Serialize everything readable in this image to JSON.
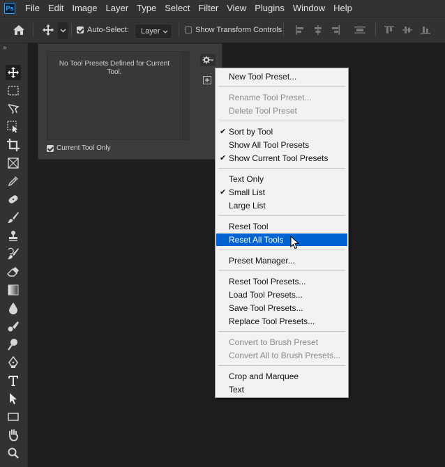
{
  "menubar": {
    "logo": "Ps",
    "items": [
      "File",
      "Edit",
      "Image",
      "Layer",
      "Type",
      "Select",
      "Filter",
      "View",
      "Plugins",
      "Window",
      "Help"
    ]
  },
  "options": {
    "auto_select_label": "Auto-Select:",
    "auto_select_checked": true,
    "target_value": "Layer",
    "transform_label": "Show Transform Controls",
    "transform_checked": false
  },
  "preset_panel": {
    "message": "No Tool Presets Defined for Current Tool.",
    "current_tool_only_label": "Current Tool Only",
    "current_tool_only_checked": true
  },
  "menu": {
    "items": [
      {
        "label": "New Tool Preset...",
        "enabled": true,
        "checked": false
      },
      {
        "label": "Rename Tool Preset...",
        "enabled": false,
        "checked": false
      },
      {
        "label": "Delete Tool Preset",
        "enabled": false,
        "checked": false
      },
      {
        "label": "Sort by Tool",
        "enabled": true,
        "checked": true
      },
      {
        "label": "Show All Tool Presets",
        "enabled": true,
        "checked": false
      },
      {
        "label": "Show Current Tool Presets",
        "enabled": true,
        "checked": true
      },
      {
        "label": "Text Only",
        "enabled": true,
        "checked": false
      },
      {
        "label": "Small List",
        "enabled": true,
        "checked": true
      },
      {
        "label": "Large List",
        "enabled": true,
        "checked": false
      },
      {
        "label": "Reset Tool",
        "enabled": true,
        "checked": false
      },
      {
        "label": "Reset All Tools",
        "enabled": true,
        "checked": false,
        "highlighted": true
      },
      {
        "label": "Preset Manager...",
        "enabled": true,
        "checked": false
      },
      {
        "label": "Reset Tool Presets...",
        "enabled": true,
        "checked": false
      },
      {
        "label": "Load Tool Presets...",
        "enabled": true,
        "checked": false
      },
      {
        "label": "Save Tool Presets...",
        "enabled": true,
        "checked": false
      },
      {
        "label": "Replace Tool Presets...",
        "enabled": true,
        "checked": false
      },
      {
        "label": "Convert to Brush Preset",
        "enabled": false,
        "checked": false
      },
      {
        "label": "Convert All to Brush Presets...",
        "enabled": false,
        "checked": false
      },
      {
        "label": "Crop and Marquee",
        "enabled": true,
        "checked": false
      },
      {
        "label": "Text",
        "enabled": true,
        "checked": false
      }
    ],
    "check_glyph": "✔"
  },
  "colors": {
    "highlight": "#0063d1",
    "app_bg": "#1e1e1e",
    "panel_bg": "#323232"
  },
  "tools": [
    "move-tool",
    "marquee-tool",
    "lasso-tool",
    "object-select-tool",
    "crop-tool",
    "frame-tool",
    "eyedropper-tool",
    "healing-brush-tool",
    "brush-tool",
    "clone-stamp-tool",
    "history-brush-tool",
    "eraser-tool",
    "gradient-tool",
    "blur-tool",
    "smudge-tool",
    "dodge-tool",
    "pen-tool",
    "type-tool",
    "path-select-tool",
    "rectangle-tool",
    "hand-tool",
    "zoom-tool"
  ]
}
